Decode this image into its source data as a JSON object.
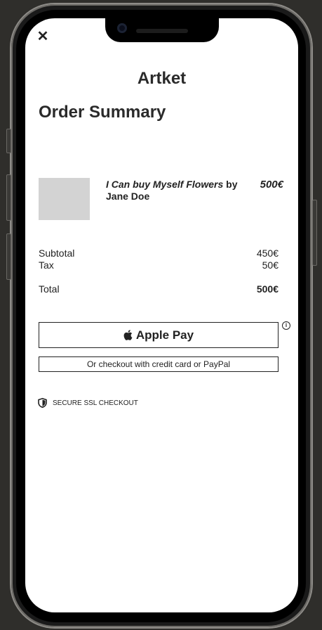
{
  "app": {
    "brand": "Artket",
    "close_icon": "✕"
  },
  "page": {
    "title": "Order Summary"
  },
  "item": {
    "title_italic": "I Can buy Myself Flowers",
    "title_suffix": " by Jane Doe",
    "price": "500€"
  },
  "summary": {
    "subtotal_label": "Subtotal",
    "subtotal_value": "450€",
    "tax_label": "Tax",
    "tax_value": "50€",
    "total_label": "Total",
    "total_value": "500€"
  },
  "payment": {
    "apple_pay_label": "Apple Pay",
    "info_icon": "ⓘ",
    "alt_checkout_label": "Or checkout with credit card or PayPal"
  },
  "security": {
    "label": "SECURE SSL CHECKOUT"
  }
}
